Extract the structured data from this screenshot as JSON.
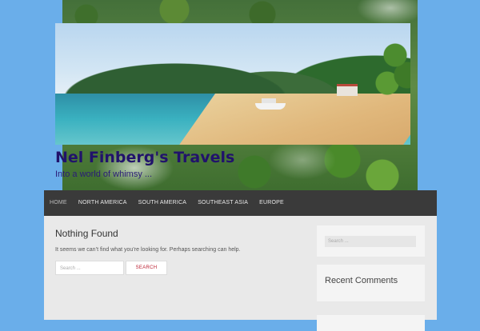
{
  "site": {
    "title": "Nel Finberg's Travels",
    "tagline": "Into a world of whimsy ..."
  },
  "nav": {
    "items": [
      {
        "label": "HOME",
        "active": true
      },
      {
        "label": "NORTH AMERICA",
        "active": false
      },
      {
        "label": "SOUTH AMERICA",
        "active": false
      },
      {
        "label": "SOUTHEAST ASIA",
        "active": false
      },
      {
        "label": "EUROPE",
        "active": false
      }
    ]
  },
  "main": {
    "heading": "Nothing Found",
    "message": "It seems we can’t find what you’re looking for. Perhaps searching can help.",
    "search_placeholder": "Search ...",
    "search_button": "SEARCH"
  },
  "sidebar": {
    "search_placeholder": "Search ...",
    "recent_comments_title": "Recent Comments"
  },
  "colors": {
    "page_background": "#6aaeea",
    "title": "#21126b",
    "nav_background": "#3a3a3a",
    "search_button_text": "#b23"
  }
}
